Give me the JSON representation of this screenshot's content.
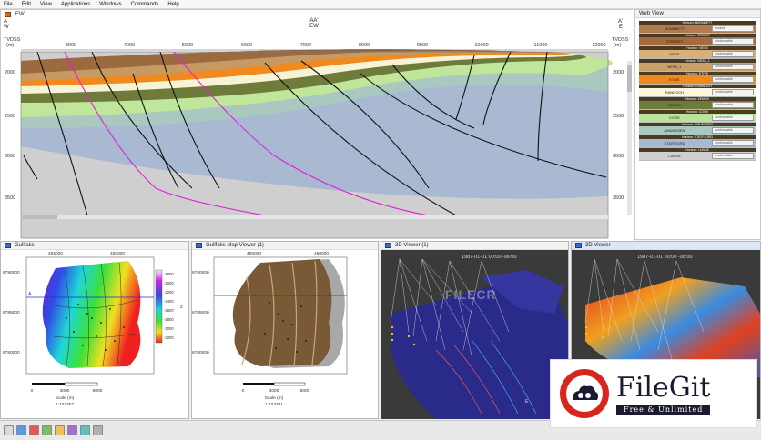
{
  "menu": [
    "File",
    "Edit",
    "View",
    "Applications",
    "Windows",
    "Commands",
    "Help"
  ],
  "section": {
    "tab_label": "EW",
    "left_end_top": "A",
    "left_end_bottom": "W",
    "center_top": "AA'",
    "center_bottom": "EW",
    "right_end_top": "A'",
    "right_end_bottom": "E",
    "depth_title": "TVDSS",
    "depth_unit": "(m)",
    "x_ticks": [
      "3000",
      "4000",
      "5000",
      "6000",
      "7000",
      "8000",
      "9000",
      "10000",
      "11000",
      "12000"
    ],
    "y_ticks": [
      "2000",
      "2500",
      "3000",
      "3500"
    ]
  },
  "webview": {
    "title": "Web View",
    "zones": [
      {
        "horizon": "Horizon: BUNNBETT",
        "name": "BUNNBETT",
        "state": "eroded",
        "color": "#b07c4f"
      },
      {
        "horizon": "Horizon: TRERET",
        "name": "TERERET",
        "state": "conformable",
        "color": "#a66a3e"
      },
      {
        "horizon": "Horizon: NESS",
        "name": "NESS",
        "state": "conformable",
        "color": "#d9b07a"
      },
      {
        "horizon": "Horizon: NESS_1",
        "name": "NESS_1",
        "state": "conformable",
        "color": "#caa06a"
      },
      {
        "horizon": "Horizon: ETIVE",
        "name": "ETIVE",
        "state": "conformable",
        "color": "#f08a1e"
      },
      {
        "horizon": "Horizon: RANNOCH",
        "name": "RANNOCH",
        "state": "conformable",
        "color": "#fbf7dc"
      },
      {
        "horizon": "Horizon: DRAKE",
        "name": "DRAKE",
        "state": "conformable",
        "color": "#6f7b3a"
      },
      {
        "horizon": "Horizon: COOK",
        "name": "COOK",
        "state": "conformable",
        "color": "#b9e59a"
      },
      {
        "horizon": "Horizon: AMUNDSEN",
        "name": "AMUNDSEN",
        "state": "conformable",
        "color": "#a9c9c0"
      },
      {
        "horizon": "Horizon: STATFJORD",
        "name": "STATFJORD",
        "state": "conformable",
        "color": "#a5b9d3"
      },
      {
        "horizon": "Horizon: LUNDE",
        "name": "LUNDE",
        "state": "conformable",
        "color": "#cfcfcf"
      }
    ]
  },
  "map1": {
    "title": "Gullfaks",
    "x_ticks": [
      "455000",
      "460000"
    ],
    "y_ticks": [
      "6790000",
      "6785000",
      "6780000"
    ],
    "scale_ticks": [
      "0",
      "3000",
      "6000"
    ],
    "scale_label": "Scale (m)",
    "scale_ratio": "1:102767",
    "colorbar_ticks": [
      "-1800",
      "-2000",
      "-2200",
      "-2400",
      "-2600",
      "-2800",
      "-3000",
      "-3200"
    ],
    "colorbar_unit": "Z",
    "section_marker": "A"
  },
  "map2": {
    "title": "Gullfaks Map Viewer (1)",
    "x_ticks": [
      "455000",
      "460000"
    ],
    "y_ticks": [
      "6790000",
      "6785000",
      "6780000"
    ],
    "scale_ticks": [
      "0",
      "3000",
      "6000"
    ],
    "scale_label": "Scale (m)",
    "scale_ratio": "1:103391"
  },
  "view3d1": {
    "title": "3D Viewer (1)",
    "timestamp": "1987-01-01  00:00 -06:00",
    "axis_label": "E",
    "watermark": "FILECR"
  },
  "view3d2": {
    "title": "3D Viewer",
    "timestamp": "1987-01-01  00:00 -06:00"
  },
  "badge": {
    "name": "FileGit",
    "tagline": "Free & Unlimited"
  },
  "colors": {
    "accent": "#3c6fc4",
    "well_magenta": "#e020d8",
    "background_grey": "#cfcfcf"
  }
}
